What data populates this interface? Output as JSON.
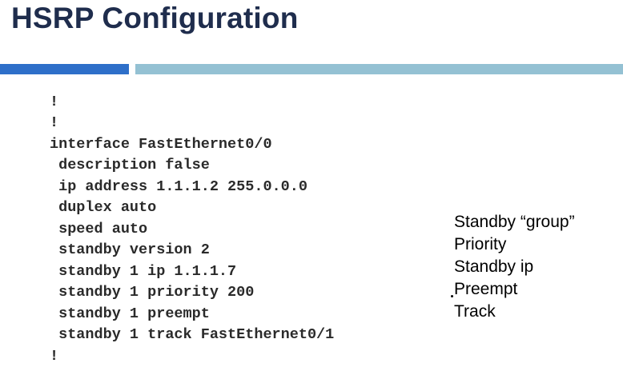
{
  "slide": {
    "title": "HSRP Configuration"
  },
  "config": {
    "lines": [
      "!",
      "!",
      "interface FastEthernet0/0",
      " description false",
      " ip address 1.1.1.2 255.0.0.0",
      " duplex auto",
      " speed auto",
      " standby version 2",
      " standby 1 ip 1.1.1.7",
      " standby 1 priority 200",
      " standby 1 preempt",
      " standby 1 track FastEthernet0/1",
      "!"
    ]
  },
  "notes": [
    "Standby “group”",
    "Priority",
    "Standby ip",
    "Preempt",
    "Track"
  ],
  "colors": {
    "title": "#1f2d4d",
    "bar_left": "#2e6fc9",
    "bar_right": "#94c1d3"
  }
}
